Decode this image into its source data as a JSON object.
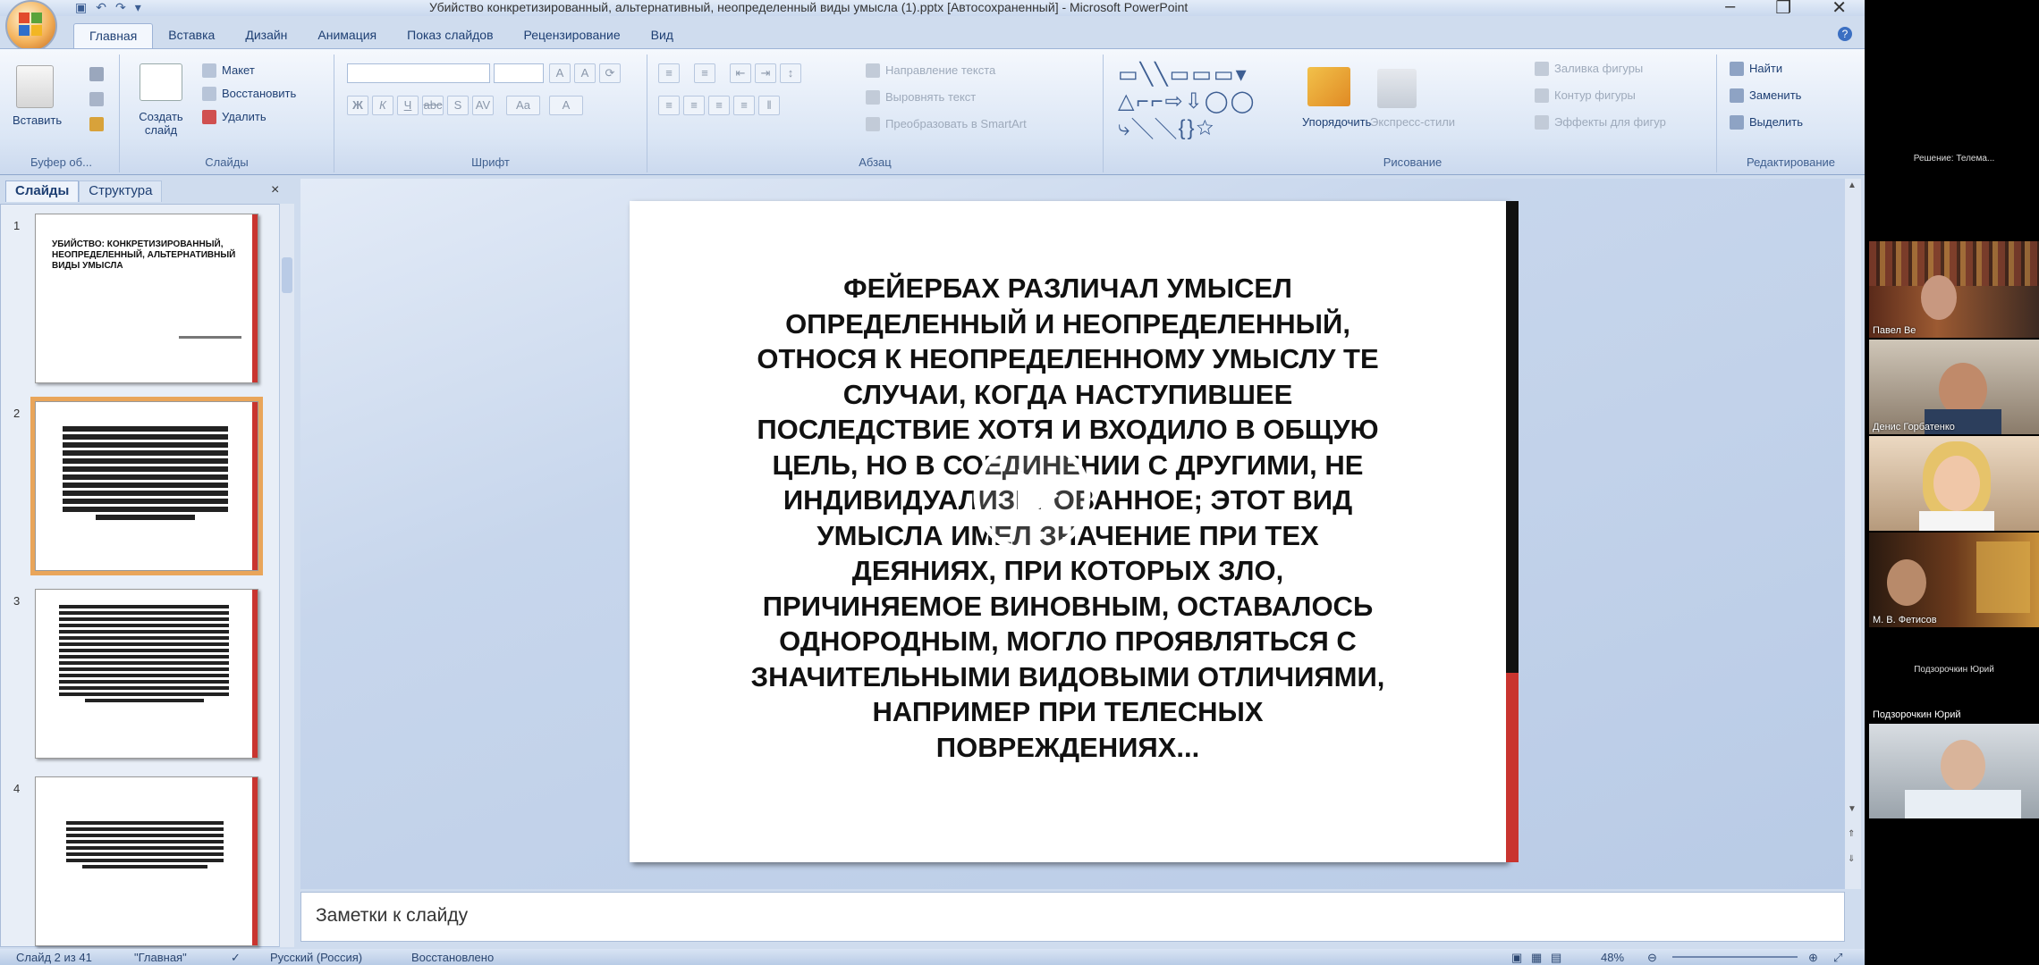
{
  "window": {
    "title": "Убийство конкретизированный, альтернативный, неопределенный виды умысла (1).pptx [Автосохраненный] - Microsoft PowerPoint",
    "controls": [
      "–",
      "❐",
      "✕"
    ]
  },
  "ribbon_tabs": [
    "Главная",
    "Вставка",
    "Дизайн",
    "Анимация",
    "Показ слайдов",
    "Рецензирование",
    "Вид"
  ],
  "ribbon": {
    "clipboard": {
      "paste": "Вставить",
      "label": "Буфер об..."
    },
    "slides": {
      "new_slide": "Создать слайд",
      "layout": "Макет",
      "reset": "Восстановить",
      "delete": "Удалить",
      "label": "Слайды"
    },
    "font": {
      "label": "Шрифт"
    },
    "paragraph": {
      "text_direction": "Направление текста",
      "align_text": "Выровнять текст",
      "convert": "Преобразовать в SmartArt",
      "label": "Абзац"
    },
    "drawing": {
      "arrange": "Упорядочить",
      "quick_styles": "Экспресс-стили",
      "fill": "Заливка фигуры",
      "outline": "Контур фигуры",
      "effects": "Эффекты для фигур",
      "label": "Рисование"
    },
    "editing": {
      "find": "Найти",
      "replace": "Заменить",
      "select": "Выделить",
      "label": "Редактирование"
    }
  },
  "left_panel": {
    "tabs": [
      "Слайды",
      "Структура"
    ],
    "thumbs": [
      {
        "num": "1",
        "title": "УБИЙСТВО: КОНКРЕТИЗИРОВАННЫЙ, НЕОПРЕДЕЛЕННЫЙ, АЛЬТЕРНАТИВНЫЙ ВИДЫ УМЫСЛА"
      },
      {
        "num": "2"
      },
      {
        "num": "3"
      },
      {
        "num": "4"
      }
    ]
  },
  "slide": {
    "text": "ФЕЙЕРБАХ РАЗЛИЧАЛ УМЫСЕЛ\nОПРЕДЕЛЕННЫЙ И НЕОПРЕДЕЛЕННЫЙ,\nОТНОСЯ К НЕОПРЕДЕЛЕННОМУ УМЫСЛУ ТЕ\nСЛУЧАИ, КОГДА НАСТУПИВШЕЕ\nПОСЛЕДСТВИЕ ХОТЯ И ВХОДИЛО В ОБЩУЮ\nЦЕЛЬ, НО В СОЕДИНЕНИИ С ДРУГИМИ, НЕ\nИНДИВИДУАЛИЗИРОВАННОЕ; ЭТОТ ВИД\nУМЫСЛА ИМЕЛ ЗНАЧЕНИЕ ПРИ ТЕХ\nДЕЯНИЯХ, ПРИ КОТОРЫХ ЗЛО,\nПРИЧИНЯЕМОЕ ВИНОВНЫМ, ОСТАВАЛОСЬ\nОДНОРОДНЫМ, МОГЛО ПРОЯВЛЯТЬСЯ С\nЗНАЧИТЕЛЬНЫМИ ВИДОВЫМИ ОТЛИЧИЯМИ,\nНАПРИМЕР ПРИ ТЕЛЕСНЫХ\nПОВРЕЖДЕНИЯХ..."
  },
  "notes": {
    "placeholder": "Заметки к слайду"
  },
  "statusbar": {
    "slide": "Слайд 2 из 41",
    "theme": "\"Главная\"",
    "language": "Русский (Россия)",
    "state": "Восстановлено",
    "zoom": "48%"
  },
  "participants": [
    {
      "name": "Павел Ве",
      "top": "Решение: Телема..."
    },
    {
      "name": "Денис Горбатенко"
    },
    {
      "name": ""
    },
    {
      "name": "М. В. Фетисов"
    },
    {
      "name": "Подзорочкин Юрий",
      "top": "Подзорочкин Юрий"
    },
    {
      "name": ""
    }
  ]
}
